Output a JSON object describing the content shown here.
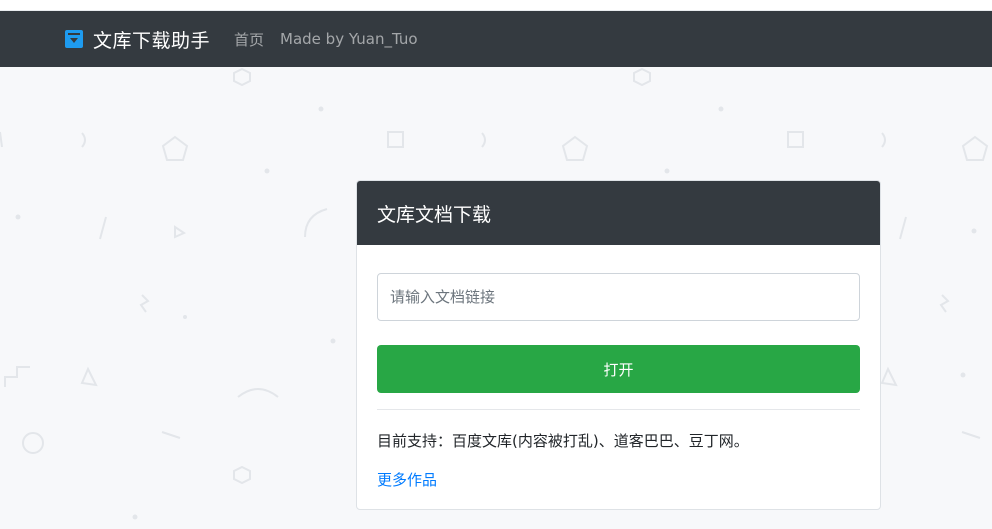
{
  "navbar": {
    "brand": "文库下载助手",
    "brand_icon": "download-box-icon",
    "links": [
      "首页",
      "Made by Yuan_Tuo"
    ]
  },
  "card": {
    "title": "文库文档下载",
    "input_placeholder": "请输入文档链接",
    "input_value": "",
    "button_label": "打开",
    "support_text": "目前支持：百度文库(内容被打乱)、道客巴巴、豆丁网。",
    "more_link": "更多作品"
  },
  "colors": {
    "navbar": "#343a40",
    "button": "#28a745",
    "link": "#007bff",
    "brand_icon": "#1e9bf0"
  }
}
